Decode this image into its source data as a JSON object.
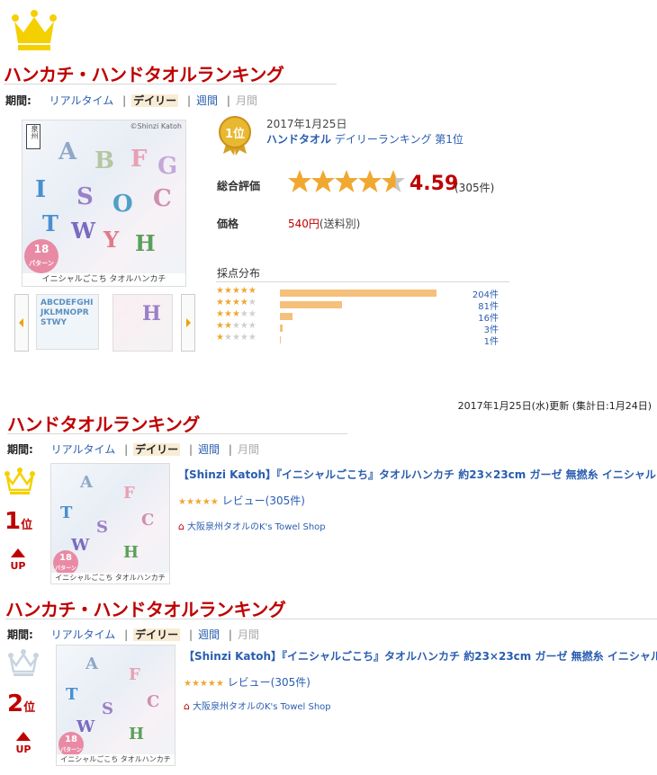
{
  "colors": {
    "brand_red": "#bf0000",
    "link_blue": "#2a5db0",
    "star": "#f0a830",
    "bar": "#f5c07a",
    "crown_gold": "#f5d000",
    "crown_silver": "#c8d4e0"
  },
  "section1": {
    "title": "ハンカチ・ハンドタオルランキング",
    "period": {
      "label": "期間:",
      "realtime": "リアルタイム",
      "daily": "デイリー",
      "weekly": "週間",
      "monthly": "月間",
      "separator": "|"
    },
    "badge": "1位",
    "date": "2017年1月25日",
    "category": "ハンドタオル",
    "ranking_text": "デイリーランキング 第1位",
    "rating_label": "総合評価",
    "rating_value": "4.59",
    "review_count": "(305件)",
    "rating_fraction": 0.918,
    "price_label": "価格",
    "price_value": "540円",
    "price_note": "(送料別)",
    "dist_title": "採点分布",
    "distribution": [
      {
        "stars": "★★★★★",
        "count_label": "204件",
        "count": 204
      },
      {
        "stars": "★★★★★",
        "count_label": "81件",
        "count": 81
      },
      {
        "stars": "★★★★★",
        "count_label": "16件",
        "count": 16
      },
      {
        "stars": "★★★★★",
        "count_label": "3件",
        "count": 3
      },
      {
        "stars": "★★★★★",
        "count_label": "1件",
        "count": 1
      }
    ],
    "image": {
      "brand_mark": "泉州",
      "watermark": "©Shinzi Katoh",
      "patterns": "18",
      "patterns_unit": "パターン",
      "caption": "イニシャルごこち タオルハンカチ"
    },
    "thumb_letters": "ABCDEFGHIJKLMNOPRSTWY",
    "nav_prev_icon": "chevron-left-icon",
    "nav_next_icon": "chevron-right-icon"
  },
  "updated_text": "2017年1月25日(水)更新 (集計日:1月24日)",
  "section2": {
    "title": "ハンドタオルランキング",
    "period": {
      "label": "期間:",
      "realtime": "リアルタイム",
      "daily": "デイリー",
      "weekly": "週間",
      "monthly": "月間",
      "separator": "|"
    },
    "rank": "1",
    "rank_unit": "位",
    "trend": "UP",
    "product_title": "【Shinzi Katoh】『イニシャルごこち』タオルハンカチ 約23×23cm ガーゼ 無撚糸 イニシャル",
    "stars": "★★★★★",
    "review": "レビュー(305件)",
    "shop": "大阪泉州タオルのK's Towel Shop",
    "image": {
      "patterns": "18",
      "patterns_unit": "パターン",
      "caption": "イニシャルごこち タオルハンカチ"
    }
  },
  "section3": {
    "title": "ハンカチ・ハンドタオルランキング",
    "period": {
      "label": "期間:",
      "realtime": "リアルタイム",
      "daily": "デイリー",
      "weekly": "週間",
      "monthly": "月間",
      "separator": "|"
    },
    "rank": "2",
    "rank_unit": "位",
    "trend": "UP",
    "product_title": "【Shinzi Katoh】『イニシャルごこち』タオルハンカチ 約23×23cm ガーゼ 無撚糸 イニシャル",
    "stars": "★★★★★",
    "review": "レビュー(305件)",
    "shop": "大阪泉州タオルのK's Towel Shop",
    "image": {
      "patterns": "18",
      "patterns_unit": "パターン",
      "caption": "イニシャルごこち タオルハンカチ"
    }
  }
}
